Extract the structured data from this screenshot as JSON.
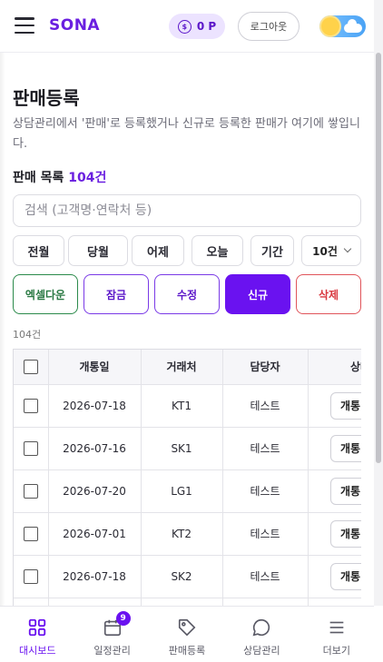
{
  "header": {
    "brand": "SONA",
    "points": "0 P",
    "coin_symbol": "$",
    "logout_label": "로그아웃",
    "theme": "light"
  },
  "page": {
    "title": "판매등록",
    "description": "상담관리에서 '판매'로 등록했거나 신규로 등록한 판매가 여기에 쌓입니다.",
    "list_label": "판매 목록",
    "list_count": "104건"
  },
  "search": {
    "placeholder": "검색 (고객명·연락처 등)",
    "value": ""
  },
  "period_filters": [
    "전월",
    "당월",
    "어제",
    "오늘",
    "기간"
  ],
  "per_page": "10건",
  "actions": {
    "excel": "엑셀다운",
    "lock": "잠금",
    "edit": "수정",
    "new": "신규",
    "delete": "삭제"
  },
  "result_count": "104건",
  "table": {
    "columns": [
      "개통일",
      "거래처",
      "담당자",
      "상태"
    ],
    "rows": [
      {
        "date": "2026-07-18",
        "partner": "KT1",
        "manager": "테스트",
        "status": "개통"
      },
      {
        "date": "2026-07-16",
        "partner": "SK1",
        "manager": "테스트",
        "status": "개통"
      },
      {
        "date": "2026-07-20",
        "partner": "LG1",
        "manager": "테스트",
        "status": "개통"
      },
      {
        "date": "2026-07-01",
        "partner": "KT2",
        "manager": "테스트",
        "status": "개통"
      },
      {
        "date": "2026-07-18",
        "partner": "SK2",
        "manager": "테스트",
        "status": "개통"
      }
    ]
  },
  "bottom_nav": [
    {
      "label": "대시보드",
      "icon": "dashboard-icon",
      "active": true
    },
    {
      "label": "일정관리",
      "icon": "calendar-icon",
      "badge": "9"
    },
    {
      "label": "판매등록",
      "icon": "tag-icon"
    },
    {
      "label": "상담관리",
      "icon": "chat-icon"
    },
    {
      "label": "더보기",
      "icon": "menu-icon"
    }
  ],
  "colors": {
    "accent": "#6a12f0",
    "excel": "#2b8a4b",
    "delete": "#d9383f"
  }
}
